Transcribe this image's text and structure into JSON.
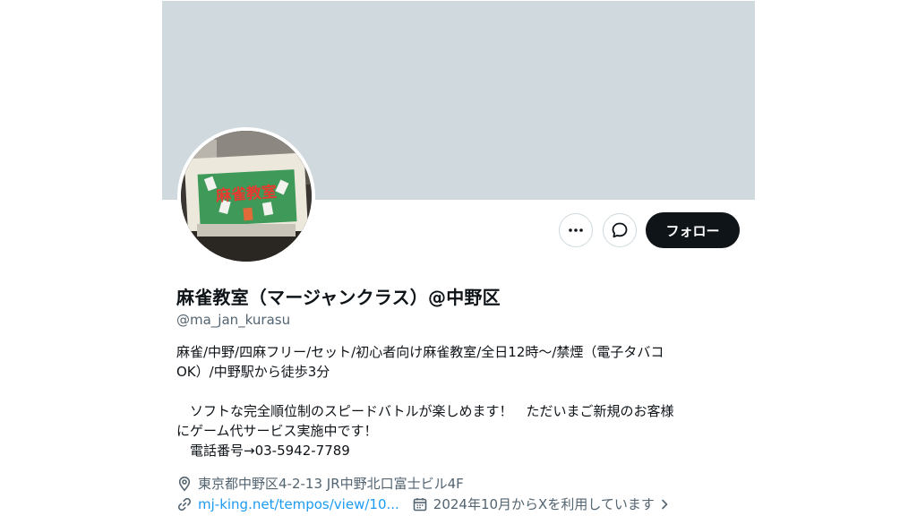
{
  "profile": {
    "display_name": "麻雀教室（マージャンクラス）@中野区",
    "handle": "@ma_jan_kurasu",
    "bio_lines": [
      "麻雀/中野/四麻フリー/セット/初心者向け麻雀教室/全日12時～/禁煙（電子タバコ",
      "OK）/中野駅から徒歩3分",
      "",
      "　ソフトな完全順位制のスピードバトルが楽しめます！　ただいまご新規のお客様",
      "にゲーム代サービス実施中です！",
      "　電話番号→03-5942-7789"
    ],
    "location": "東京都中野区4-2-13 JR中野北口富士ビル4F",
    "website": "mj-king.net/tempos/view/10...",
    "joined": "2024年10月からXを利用しています",
    "avatar_sign_text": "麻雀教室"
  },
  "actions": {
    "more_icon": "more-horizontal-icon",
    "message_icon": "message-icon",
    "follow_label": "フォロー"
  },
  "colors": {
    "banner": "#cfd9de",
    "text_primary": "#0f1419",
    "text_secondary": "#536471",
    "link": "#1d9bf0",
    "follow_bg": "#0f1419"
  }
}
